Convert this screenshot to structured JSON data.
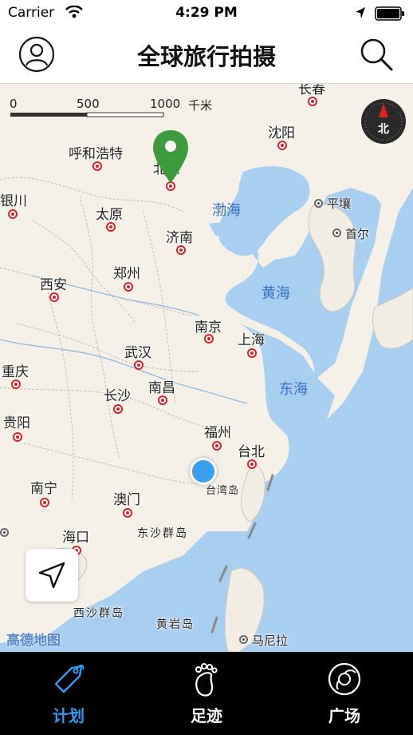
{
  "status_bar": {
    "carrier": "Carrier",
    "time": "4:29 PM"
  },
  "header": {
    "title": "全球旅行拍摄",
    "profile_icon": "person-icon",
    "search_icon": "search-icon"
  },
  "map": {
    "scale": {
      "labels": [
        "0",
        "500",
        "1000",
        "千米"
      ]
    },
    "compass_label": "北",
    "cities": [
      {
        "id": "changchun",
        "name": "长春"
      },
      {
        "id": "shenyang",
        "name": "沈阳"
      },
      {
        "id": "hohhot",
        "name": "呼和浩特"
      },
      {
        "id": "beijing",
        "name": "北京"
      },
      {
        "id": "yinchuan",
        "name": "银川"
      },
      {
        "id": "taiyuan",
        "name": "太原"
      },
      {
        "id": "jinan",
        "name": "济南"
      },
      {
        "id": "zhengzhou",
        "name": "郑州"
      },
      {
        "id": "xian",
        "name": "西安"
      },
      {
        "id": "nanjing",
        "name": "南京"
      },
      {
        "id": "shanghai",
        "name": "上海"
      },
      {
        "id": "wuhan",
        "name": "武汉"
      },
      {
        "id": "chongqing",
        "name": "重庆"
      },
      {
        "id": "changsha",
        "name": "长沙"
      },
      {
        "id": "nanchang",
        "name": "南昌"
      },
      {
        "id": "guiyang",
        "name": "贵阳"
      },
      {
        "id": "fuzhou",
        "name": "福州"
      },
      {
        "id": "taipei",
        "name": "台北"
      },
      {
        "id": "nanning",
        "name": "南宁"
      },
      {
        "id": "macau",
        "name": "澳门"
      },
      {
        "id": "haikou",
        "name": "海口"
      }
    ],
    "foreign_cities": [
      {
        "id": "pyongyang",
        "name": "平壤"
      },
      {
        "id": "seoul",
        "name": "首尔"
      },
      {
        "id": "manila",
        "name": "马尼拉"
      }
    ],
    "seas": [
      {
        "id": "bohai",
        "name": "渤海"
      },
      {
        "id": "huanghai",
        "name": "黄海"
      },
      {
        "id": "donghai",
        "name": "东海"
      }
    ],
    "islands": [
      {
        "id": "taiwan",
        "name": "台湾岛"
      },
      {
        "id": "dongsha",
        "name": "东沙群岛"
      },
      {
        "id": "xisha",
        "name": "西沙群岛"
      },
      {
        "id": "huangyan",
        "name": "黄岩岛"
      }
    ],
    "watermark": "高德地图"
  },
  "tabs": [
    {
      "id": "plan",
      "label": "计划",
      "icon": "tag-icon",
      "active": true
    },
    {
      "id": "footprint",
      "label": "足迹",
      "icon": "footprint-icon",
      "active": false
    },
    {
      "id": "square",
      "label": "广场",
      "icon": "disc-icon",
      "active": false
    }
  ],
  "colors": {
    "accent": "#2e9cf0",
    "city_marker": "#d6232a",
    "pin": "#3d9b3d",
    "sea": "#a7cdee",
    "land": "#f5f1e8"
  }
}
